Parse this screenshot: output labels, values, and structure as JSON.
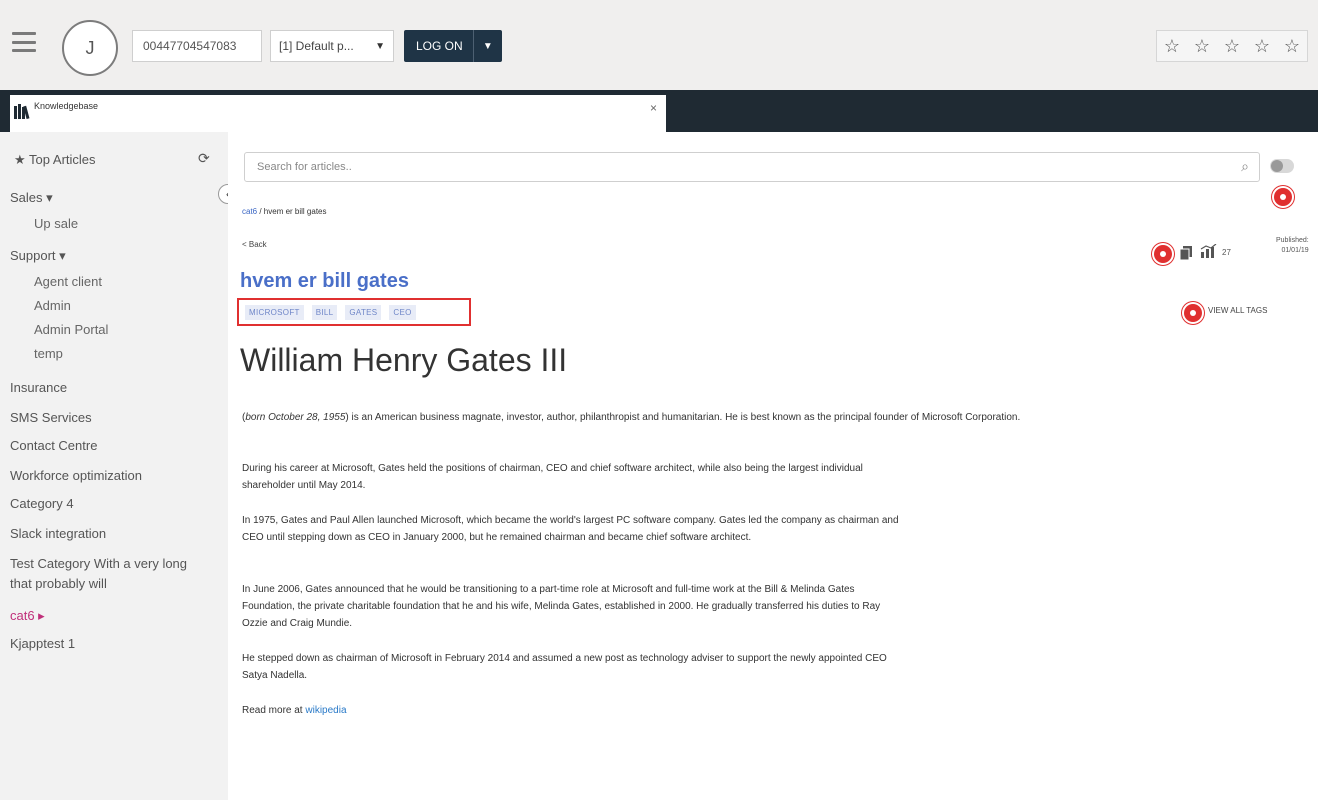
{
  "topbar": {
    "avatar_initial": "J",
    "phone": "00447704547083",
    "profile": "[1] Default p...",
    "logon_label": "LOG ON"
  },
  "tab": {
    "title": "Knowledgebase",
    "close": "×"
  },
  "sidebar": {
    "top_articles": "Top Articles",
    "items": [
      "Sales ▾",
      "Up sale",
      "Support ▾",
      "Agent client",
      "Admin",
      "Admin Portal",
      "temp",
      "Insurance",
      "SMS Services",
      "Contact Centre",
      "Workforce optimization",
      "Category 4",
      "Slack integration",
      "Test Category With a very long",
      "that probably will",
      "cat6 ▸",
      "Kjapptest 1"
    ]
  },
  "main": {
    "search_placeholder": "Search for articles..",
    "breadcrumb_link": "cat6",
    "breadcrumb_rest": " / hvem er bill gates",
    "back": "< Back",
    "title": "hvem er bill gates",
    "tags": [
      "MICROSOFT",
      "BILL",
      "GATES",
      "CEO"
    ],
    "views": "27",
    "published_label": "Published:",
    "published_date": "01/01/19",
    "view_all_tags": "VIEW ALL TAGS",
    "heading": "William Henry Gates III",
    "intro_italic": "born October 28, 1955",
    "intro_rest": ") is an American business magnate, investor, author, philanthropist and humanitarian. He is best known as the principal founder of Microsoft Corporation.",
    "paragraphs": [
      "During his career at Microsoft, Gates held the positions of chairman, CEO and chief software architect, while also being the largest individual shareholder until May 2014.",
      "In 1975, Gates and Paul Allen launched Microsoft, which became the world's largest PC software company. Gates led the company as chairman and CEO until stepping down as CEO in January 2000, but he remained chairman and became chief software architect.",
      "In June 2006, Gates announced that he would be transitioning to a part-time role at Microsoft and full-time work at the Bill & Melinda Gates Foundation, the private charitable foundation that he and his wife, Melinda Gates, established in 2000. He gradually transferred his duties to Ray Ozzie and Craig Mundie.",
      "He stepped down as chairman of Microsoft in February 2014 and assumed a new post as technology adviser to support the newly appointed CEO Satya Nadella."
    ],
    "read_more_prefix": "Read more at ",
    "read_more_link": "wikipedia"
  }
}
